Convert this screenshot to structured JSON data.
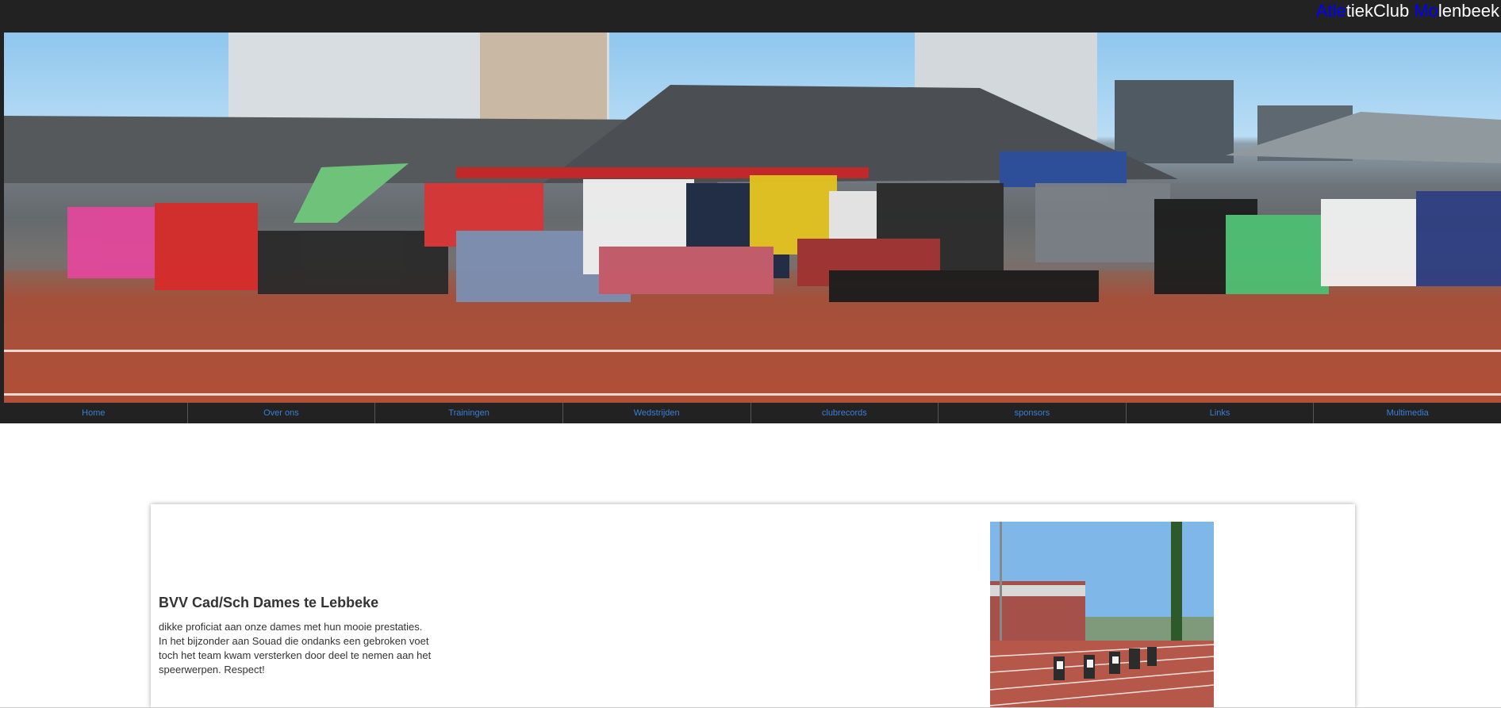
{
  "brand": {
    "part1_blue": "Atle",
    "part1_white": "tiekClub ",
    "part2_blue": "Mo",
    "part2_white": "lenbeek"
  },
  "hero_image": {
    "icon": "group-photo-image"
  },
  "nav": {
    "items": [
      {
        "label": "Home"
      },
      {
        "label": "Over ons"
      },
      {
        "label": "Trainingen"
      },
      {
        "label": "Wedstrijden"
      },
      {
        "label": "clubrecords"
      },
      {
        "label": "sponsors"
      },
      {
        "label": "Links"
      },
      {
        "label": "Multimedia"
      }
    ]
  },
  "post": {
    "title": "BVV Cad/Sch Dames te Lebbeke",
    "body_lines": [
      "dikke proficiat aan onze dames met hun mooie prestaties.",
      "In het bijzonder aan Souad die ondanks een gebroken voet",
      "toch het team kwam versterken door deel te nemen aan het",
      "speerwerpen. Respect!"
    ],
    "image_icon": "sprint-start-photo"
  },
  "colors": {
    "bar": "#222222",
    "nav_link": "#3b7fd6",
    "brand_blue": "#0000ff"
  }
}
